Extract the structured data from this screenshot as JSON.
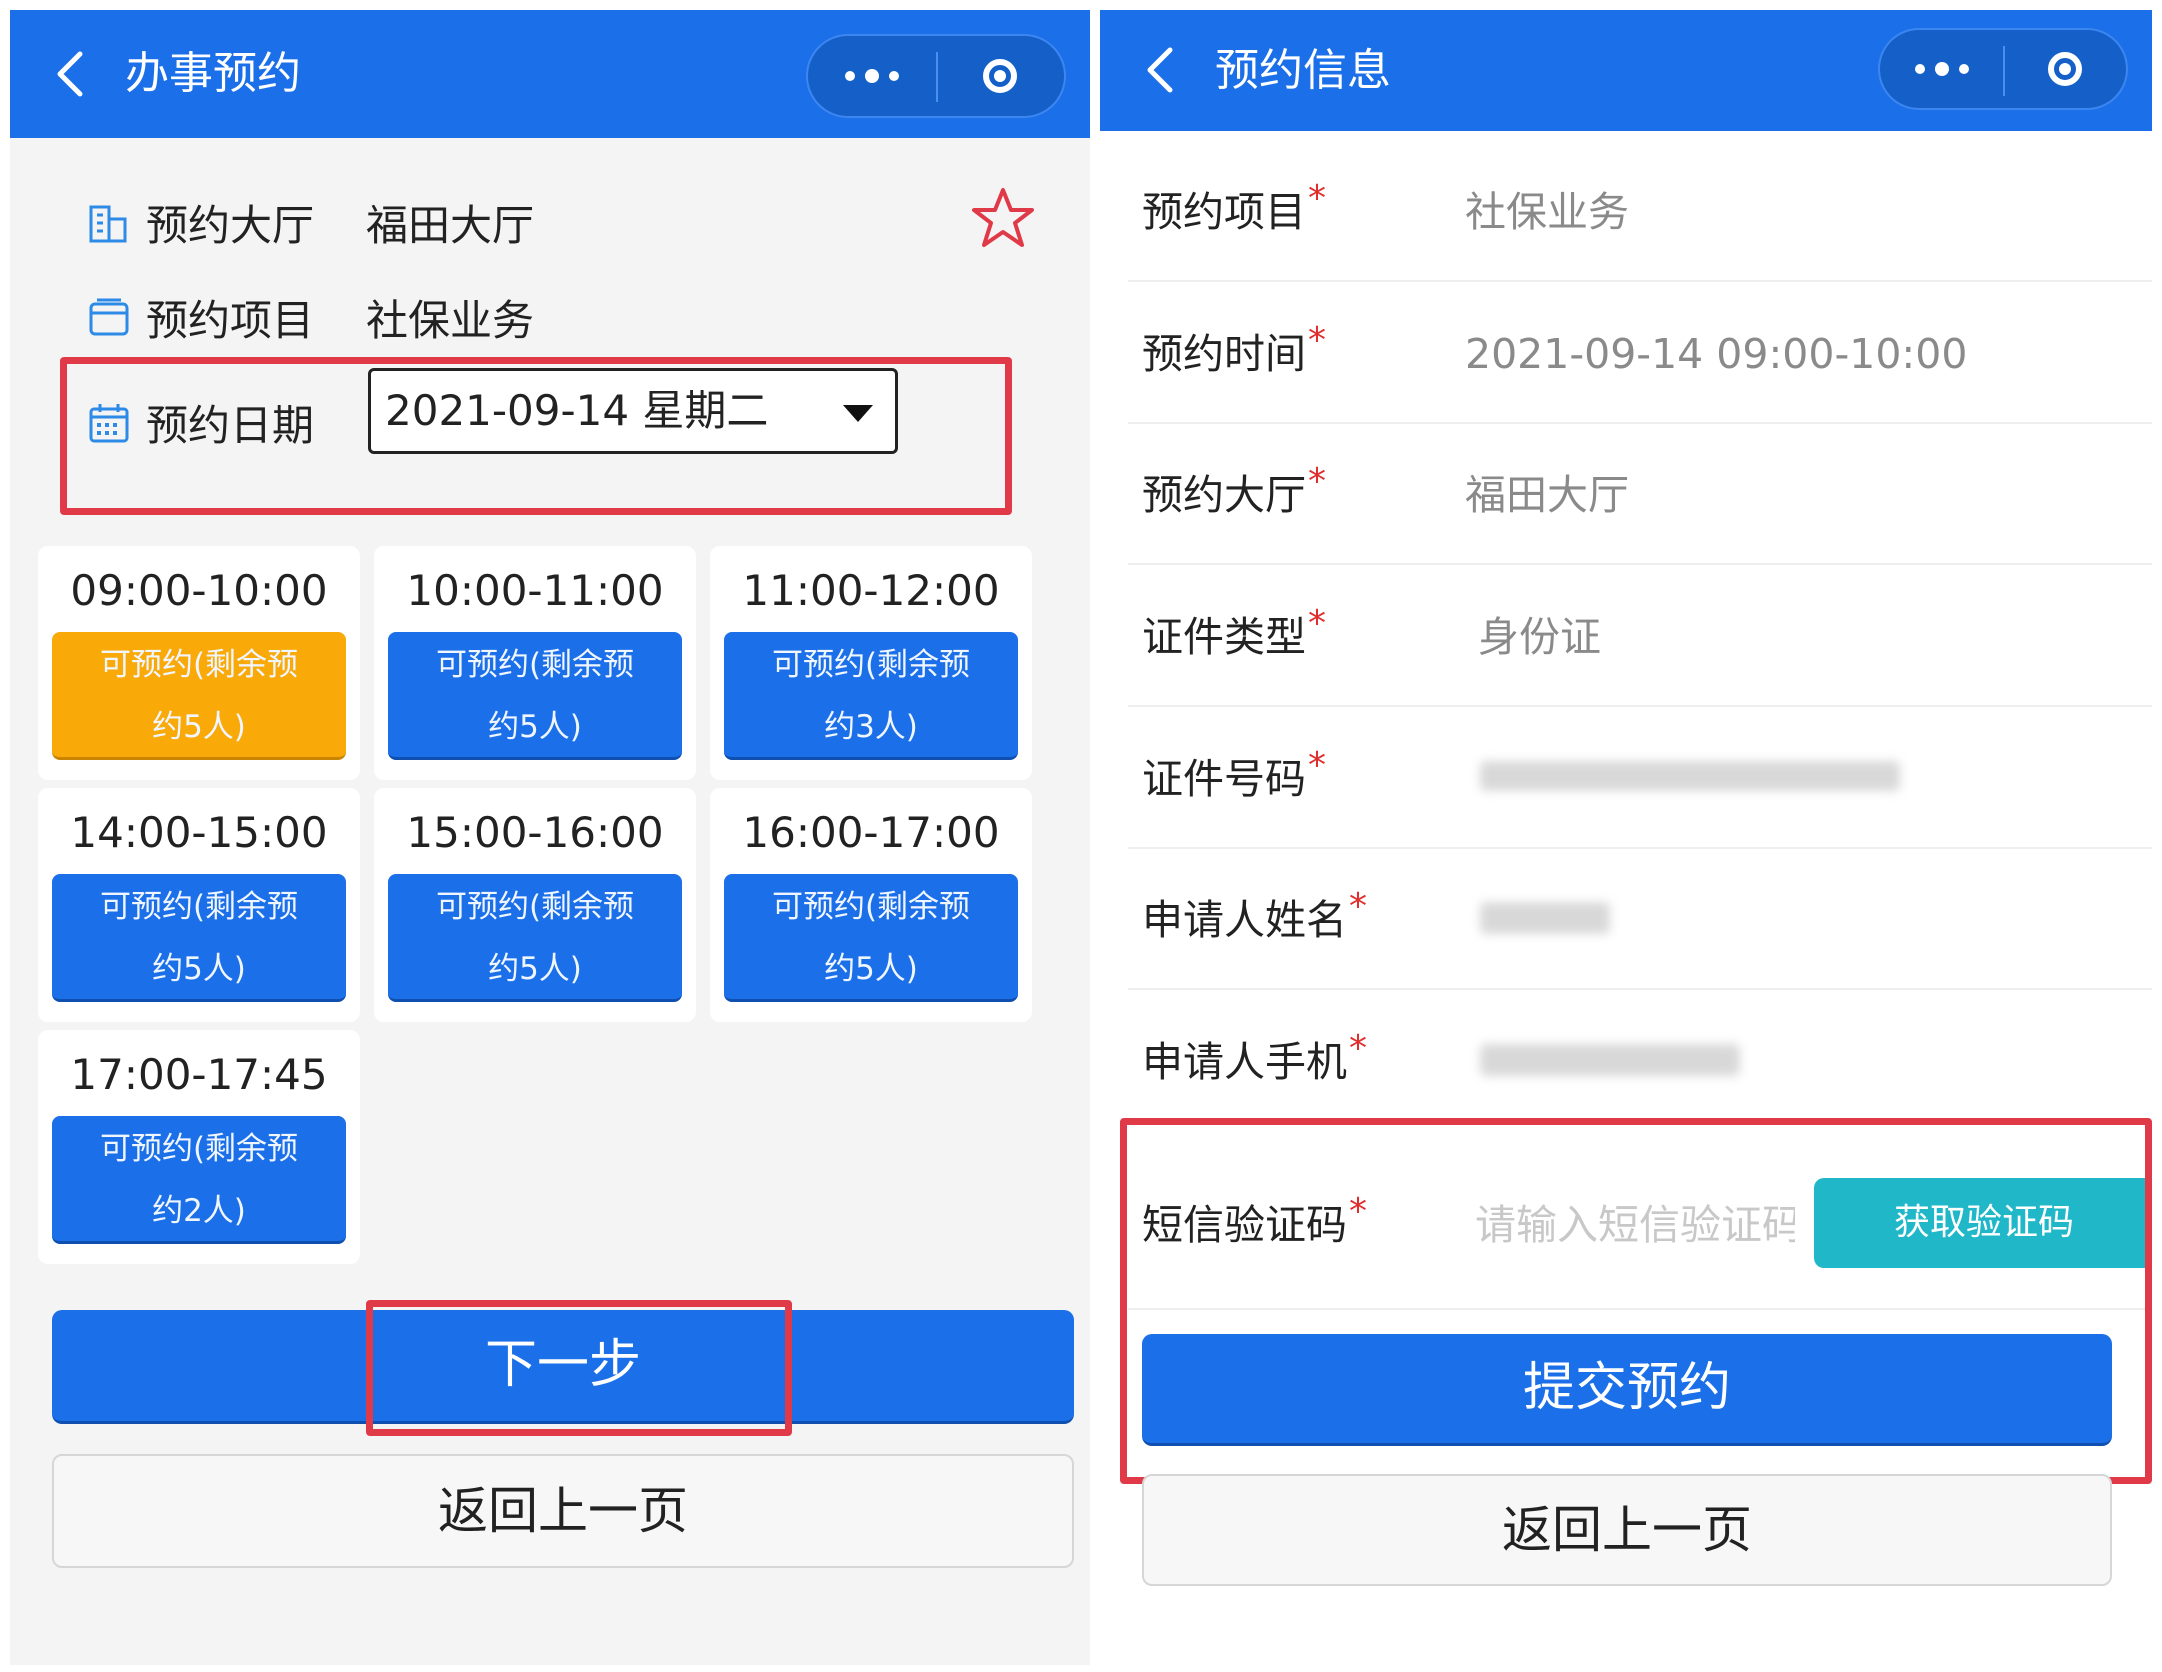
{
  "left": {
    "nav": {
      "title": "办事预约"
    },
    "info": {
      "hall_label": "预约大厅",
      "hall_value": "福田大厅",
      "item_label": "预约项目",
      "item_value": "社保业务",
      "date_label": "预约日期",
      "date_value": "2021-09-14 星期二"
    },
    "slots": [
      {
        "time": "09:00-10:00",
        "status_line1": "可预约(剩余预",
        "status_line2": "约5人)",
        "selected": true
      },
      {
        "time": "10:00-11:00",
        "status_line1": "可预约(剩余预",
        "status_line2": "约5人)",
        "selected": false
      },
      {
        "time": "11:00-12:00",
        "status_line1": "可预约(剩余预",
        "status_line2": "约3人)",
        "selected": false
      },
      {
        "time": "14:00-15:00",
        "status_line1": "可预约(剩余预",
        "status_line2": "约5人)",
        "selected": false
      },
      {
        "time": "15:00-16:00",
        "status_line1": "可预约(剩余预",
        "status_line2": "约5人)",
        "selected": false
      },
      {
        "time": "16:00-17:00",
        "status_line1": "可预约(剩余预",
        "status_line2": "约5人)",
        "selected": false
      },
      {
        "time": "17:00-17:45",
        "status_line1": "可预约(剩余预",
        "status_line2": "约2人)",
        "selected": false
      }
    ],
    "next_button": "下一步",
    "back_button": "返回上一页"
  },
  "right": {
    "nav": {
      "title": "预约信息"
    },
    "fields": [
      {
        "label": "预约项目",
        "required_mark": "*",
        "value": "社保业务"
      },
      {
        "label": "预约时间",
        "required_mark": "*",
        "value": "2021-09-14 09:00-10:00"
      },
      {
        "label": "预约大厅",
        "required_mark": "*",
        "value": "福田大厅"
      },
      {
        "label": "证件类型",
        "required_mark": "*",
        "value": "身份证"
      },
      {
        "label": "证件号码",
        "required_mark": "*",
        "value": ""
      },
      {
        "label": "申请人姓名",
        "required_mark": "*",
        "value": ""
      },
      {
        "label": "申请人手机",
        "required_mark": "*",
        "value": ""
      }
    ],
    "sms": {
      "label": "短信验证码",
      "required_mark": "*",
      "placeholder": "请输入短信验证码",
      "get_code_button": "获取验证码"
    },
    "submit_button": "提交预约",
    "back_button": "返回上一页"
  },
  "colors": {
    "primary": "#1b6fe8",
    "selected_slot": "#f9a908",
    "highlight": "#e03a48",
    "teal_button": "#20b8c9"
  }
}
